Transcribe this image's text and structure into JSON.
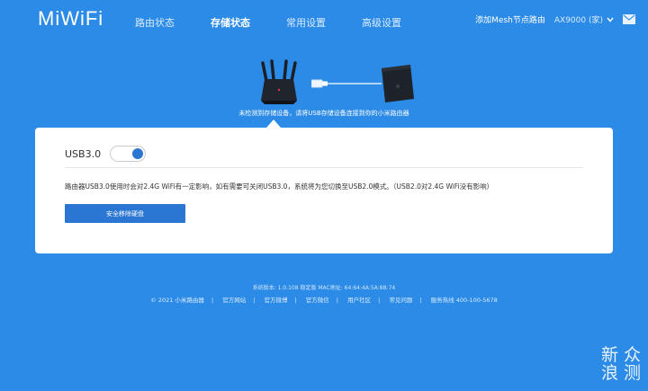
{
  "header": {
    "logo": "MiWiFi",
    "nav": [
      "路由状态",
      "存储状态",
      "常用设置",
      "高级设置"
    ],
    "active_index": 1,
    "mesh_link": "添加Mesh节点路由",
    "device": "AX9000 (家)"
  },
  "hero": {
    "hint": "未检测到存储设备，请将USB存储设备连接到你的小米路由器"
  },
  "card": {
    "usb_label": "USB3.0",
    "usb_enabled": true,
    "description": "路由器USB3.0使用时会对2.4G WiFi有一定影响，如有需要可关闭USB3.0，系统将为您切换至USB2.0模式。（USB2.0对2.4G WiFi没有影响）",
    "eject_button": "安全移除硬盘"
  },
  "footer": {
    "version_line": "系统版本: 1.0.108 稳定版   MAC地址: 64:64:4A:5A:8B:74",
    "links": [
      "© 2021 小米路由器",
      "官方网站",
      "官方微博",
      "官方微信",
      "用户社区",
      "常见问题",
      "服务热线 400-100-5678"
    ]
  },
  "watermark": {
    "line1": "新 众",
    "line2": "浪 测"
  },
  "colors": {
    "background": "#2c8be6",
    "primary_button": "#2a76d2"
  }
}
